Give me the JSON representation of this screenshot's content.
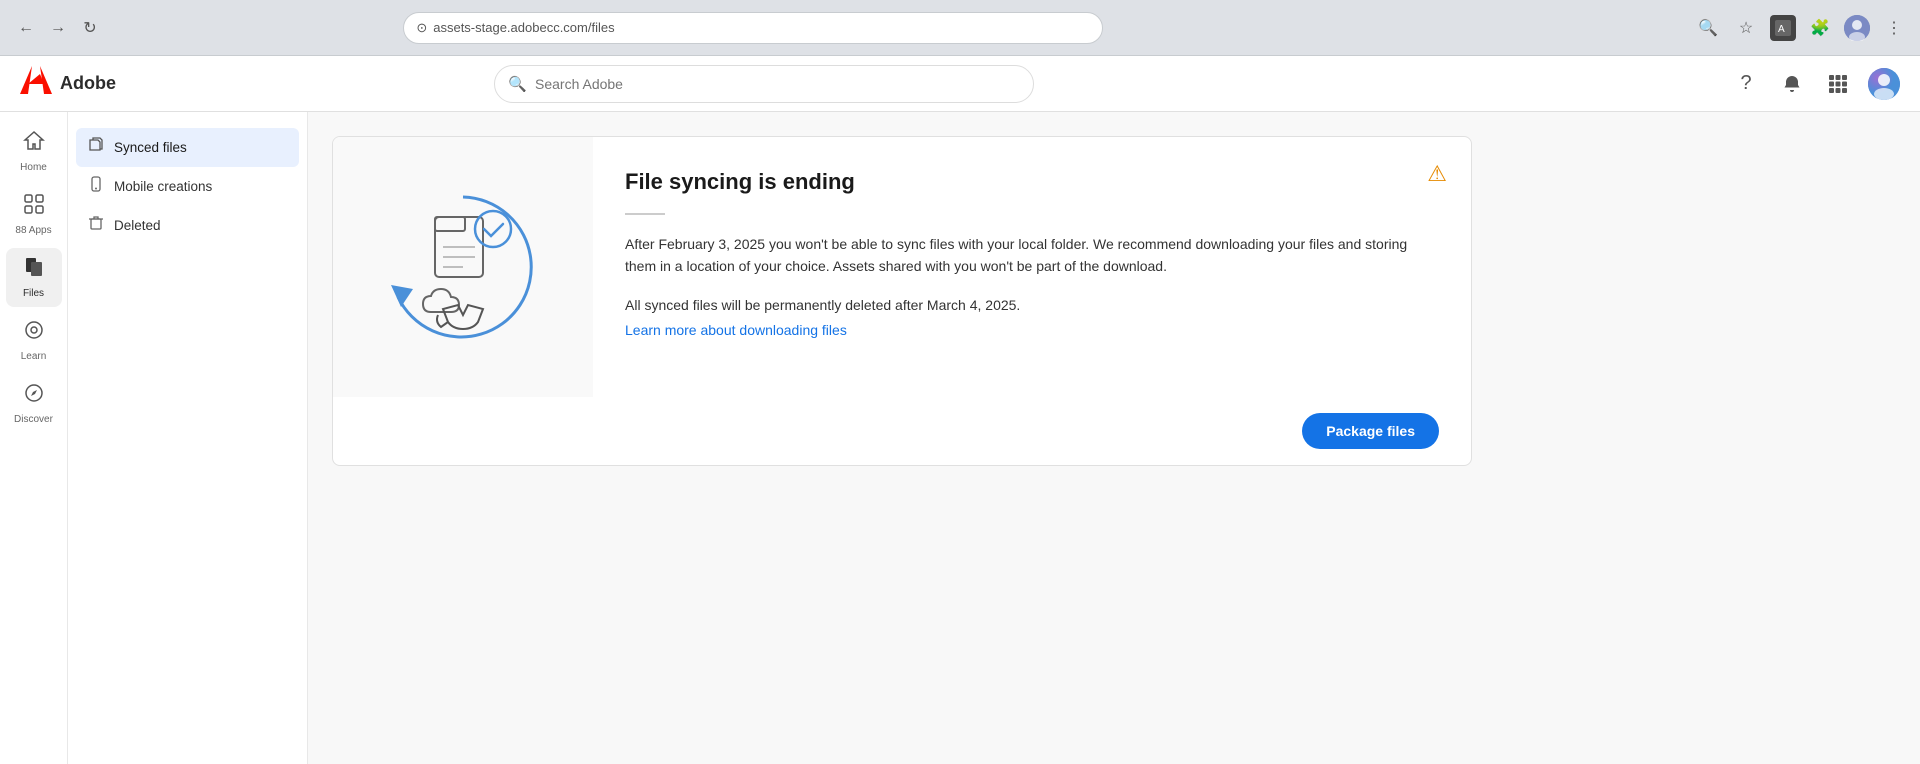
{
  "browser": {
    "url": "assets-stage.adobecc.com/files",
    "back_disabled": false,
    "forward_disabled": false
  },
  "header": {
    "logo_text": "Adobe",
    "search_placeholder": "Search Adobe",
    "help_tooltip": "Help",
    "notifications_tooltip": "Notifications",
    "apps_tooltip": "Apps"
  },
  "sidebar": {
    "items": [
      {
        "id": "home",
        "label": "Home",
        "icon": "🏠"
      },
      {
        "id": "apps",
        "label": "88 Apps",
        "icon": "⊞"
      },
      {
        "id": "files",
        "label": "Files",
        "icon": "📁",
        "active": true
      },
      {
        "id": "learn",
        "label": "Learn",
        "icon": "💡"
      },
      {
        "id": "discover",
        "label": "Discover",
        "icon": "🔄"
      }
    ]
  },
  "left_panel": {
    "items": [
      {
        "id": "synced",
        "label": "Synced files",
        "icon": "📄",
        "active": true
      },
      {
        "id": "mobile",
        "label": "Mobile creations",
        "icon": "📱",
        "active": false
      },
      {
        "id": "deleted",
        "label": "Deleted",
        "icon": "🗑",
        "active": false
      }
    ]
  },
  "banner": {
    "title": "File syncing is ending",
    "divider": true,
    "body": "After February 3, 2025 you won't be able to sync files with your local folder. We recommend downloading your files and storing them in a location of your choice. Assets shared with you won't be part of the download.",
    "note": "All synced files will be permanently deleted after March 4, 2025.",
    "link_text": "Learn more about downloading files",
    "link_url": "#",
    "warning_icon": "⚠",
    "package_button": "Package files"
  }
}
